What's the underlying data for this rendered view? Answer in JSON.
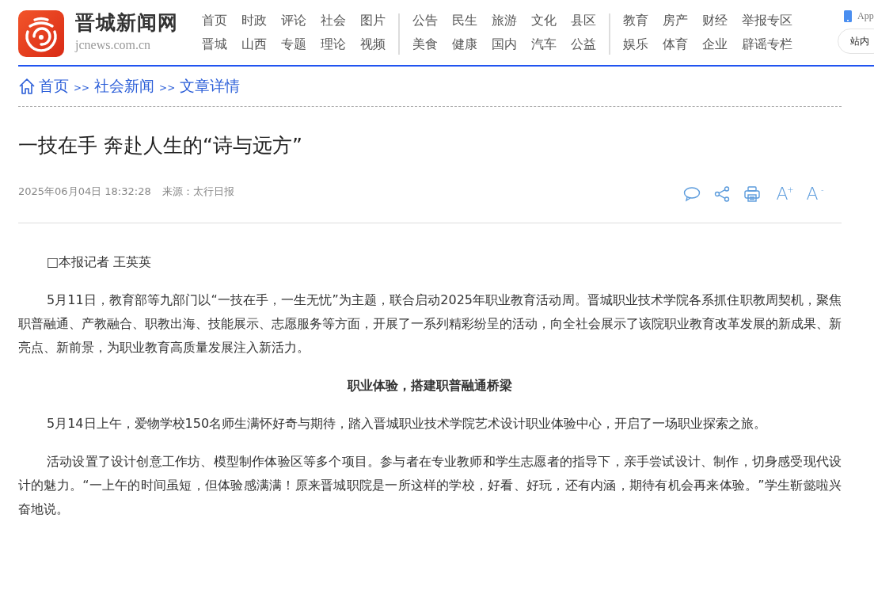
{
  "site": {
    "name": "晋城新闻网",
    "domain": "jcnews.com.cn"
  },
  "nav_groups": [
    {
      "rows": [
        [
          "首页",
          "时政",
          "评论",
          "社会",
          "图片"
        ],
        [
          "晋城",
          "山西",
          "专题",
          "理论",
          "视频"
        ]
      ]
    },
    {
      "rows": [
        [
          "公告",
          "民生",
          "旅游",
          "文化",
          "县区"
        ],
        [
          "美食",
          "健康",
          "国内",
          "汽车",
          "公益"
        ]
      ]
    },
    {
      "rows": [
        [
          "教育",
          "房产",
          "财经",
          "举报专区"
        ],
        [
          "娱乐",
          "体育",
          "企业",
          "辟谣专栏"
        ]
      ]
    }
  ],
  "app_label": "App",
  "search_button": "站内",
  "breadcrumb": [
    {
      "label": "首页",
      "sep": ">>"
    },
    {
      "label": "社会新闻",
      "sep": ">>"
    },
    {
      "label": "文章详情"
    }
  ],
  "article": {
    "title": "一技在手 奔赴人生的“诗与远方”",
    "date": "2025年06月04日 18:32:28",
    "source": "来源：太行日报",
    "tools": [
      {
        "kind": "comment"
      },
      {
        "kind": "share"
      },
      {
        "kind": "print"
      },
      {
        "kind": "font",
        "letter": "A",
        "sign": "+"
      },
      {
        "kind": "font",
        "letter": "A",
        "sign": "-"
      }
    ],
    "paragraphs": [
      {
        "kind": "text",
        "text": "□本报记者 王英英"
      },
      {
        "kind": "text",
        "text": "5月11日，教育部等九部门以“一技在手，一生无忧”为主题，联合启动2025年职业教育活动周。晋城职业技术学院各系抓住职教周契机，聚焦职普融通、产教融合、职教出海、技能展示、志愿服务等方面，开展了一系列精彩纷呈的活动，向全社会展示了该院职业教育改革发展的新成果、新亮点、新前景，为职业教育高质量发展注入新活力。"
      },
      {
        "kind": "heading",
        "text": "职业体验，搭建职普融通桥梁"
      },
      {
        "kind": "text",
        "text": "5月14日上午，爱物学校150名师生满怀好奇与期待，踏入晋城职业技术学院艺术设计职业体验中心，开启了一场职业探索之旅。"
      },
      {
        "kind": "text",
        "text": "活动设置了设计创意工作坊、模型制作体验区等多个项目。参与者在专业教师和学生志愿者的指导下，亲手尝试设计、制作，切身感受现代设计的魅力。“一上午的时间虽短，但体验感满满！原来晋城职院是一所这样的学校，好看、好玩，还有内涵，期待有机会再来体验。”学生靳懿啦兴奋地说。"
      }
    ]
  }
}
